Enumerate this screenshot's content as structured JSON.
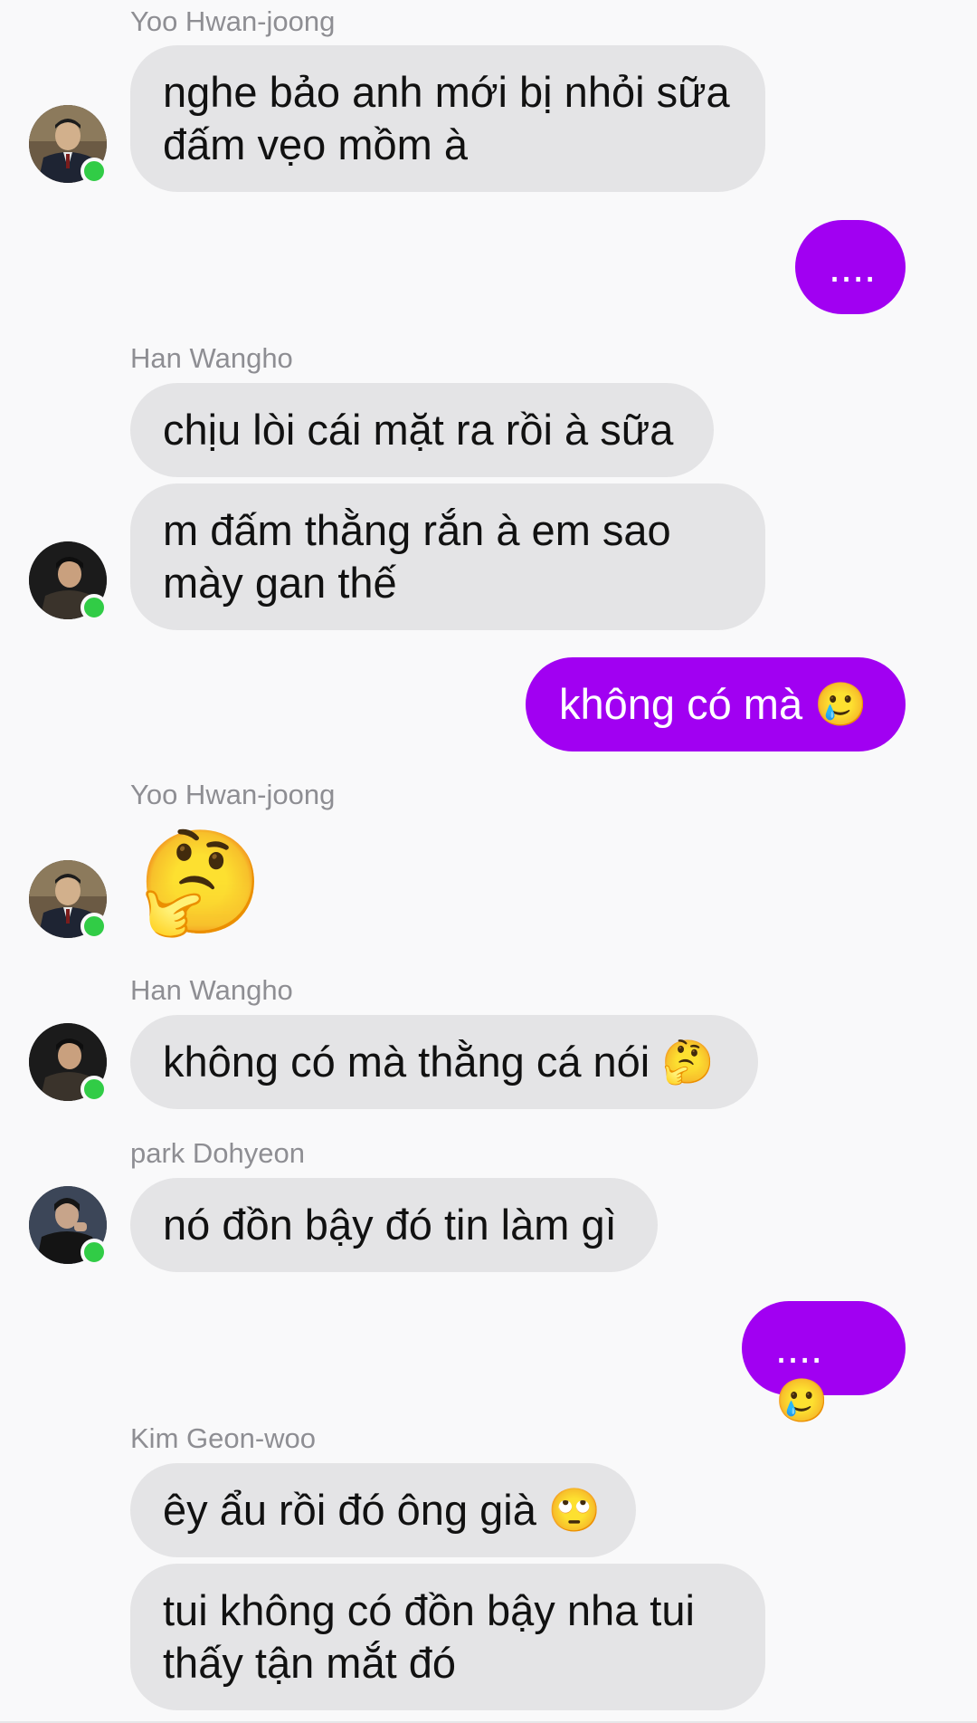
{
  "colors": {
    "background": "#f9f9fa",
    "incoming_bubble": "#e4e4e6",
    "outgoing_bubble": "#a100f2",
    "online_indicator": "#31cc46",
    "sender_name": "#8e8e93"
  },
  "chat": {
    "blocks": [
      {
        "sender": "Yoo Hwan-joong",
        "avatar": "yoo-hwan-joong-avatar",
        "messages": [
          "nghe bảo anh mới bị nhỏi sữa\nđấm vẹo mồm à"
        ]
      },
      {
        "outgoing": [
          "...."
        ]
      },
      {
        "sender": "Han Wangho",
        "avatar": "han-wangho-avatar",
        "messages": [
          "chịu lòi cái mặt ra rồi à sữa",
          "m đấm thằng rắn à em sao\nmày gan thế"
        ]
      },
      {
        "outgoing": [
          "không có mà 🥲"
        ]
      },
      {
        "sender": "Yoo Hwan-joong",
        "avatar": "yoo-hwan-joong-avatar",
        "emoji_message": "🤔"
      },
      {
        "sender": "Han Wangho",
        "avatar": "han-wangho-avatar",
        "messages": [
          "không có mà thằng cá nói 🤔"
        ]
      },
      {
        "sender": "park Dohyeon",
        "avatar": "park-dohyeon-avatar",
        "messages": [
          "nó đồn bậy đó tin làm gì"
        ]
      },
      {
        "outgoing": [
          "....🥲"
        ]
      },
      {
        "sender": "Kim Geon-woo",
        "messages": [
          "êy ẩu rồi đó ông già 🙄",
          "tui không có đồn bậy nha tui\nthấy tận mắt đó"
        ]
      }
    ]
  }
}
